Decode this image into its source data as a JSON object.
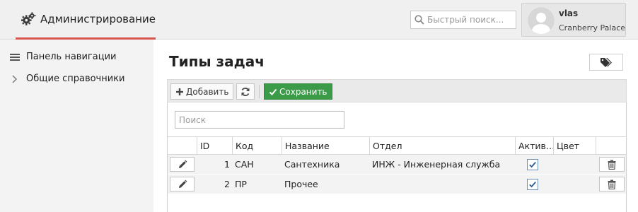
{
  "header": {
    "app_title": "Администрирование",
    "search_placeholder": "Быстрый поиск...",
    "user_name": "vlas",
    "user_org": "Cranberry Palace"
  },
  "sidebar": {
    "items": [
      {
        "label": "Панель навигации",
        "icon": "menu-icon"
      },
      {
        "label": "Общие справочники",
        "icon": "chevron-right-icon"
      }
    ]
  },
  "page": {
    "title": "Типы задач"
  },
  "toolbar": {
    "add_label": "Добавить",
    "save_label": "Сохранить"
  },
  "grid": {
    "filter_placeholder": "Поиск",
    "columns": [
      "",
      "ID",
      "Код",
      "Название",
      "Отдел",
      "Актив…",
      "Цвет",
      ""
    ],
    "rows": [
      {
        "id": "1",
        "code": "САН",
        "name": "Сантехника",
        "dept": "ИНЖ - Инженерная служба",
        "active": true,
        "color": ""
      },
      {
        "id": "2",
        "code": "ПР",
        "name": "Прочее",
        "dept": "",
        "active": true,
        "color": ""
      }
    ]
  },
  "colors": {
    "accent": "#d9534f",
    "save_green": "#3c9b48",
    "sidebar_bg": "#f3f3f3"
  }
}
